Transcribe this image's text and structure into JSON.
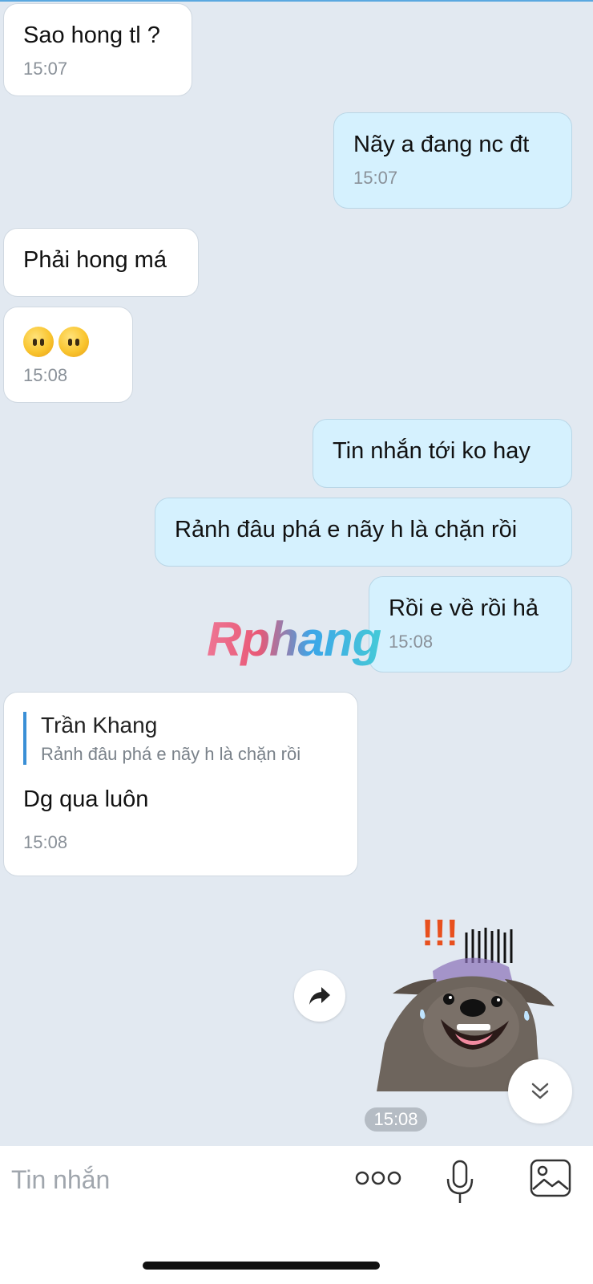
{
  "messages": [
    {
      "text": "Sao hong tl ?",
      "time": "15:07"
    },
    {
      "text": "Nãy a đang nc đt",
      "time": "15:07"
    },
    {
      "text": "Phải hong má"
    },
    {
      "emoji": [
        "neutral-face",
        "neutral-face"
      ],
      "time": "15:08"
    },
    {
      "text": "Tin nhắn tới ko hay"
    },
    {
      "text": "Rảnh đâu phá e nãy h là chặn rồi"
    },
    {
      "text": "Rồi e về rồi hả",
      "time": "15:08"
    },
    {
      "reply": {
        "author": "Trần Khang",
        "quoted": "Rảnh đâu phá e nãy h là chặn rồi"
      },
      "text": "Dg qua luôn",
      "time": "15:08"
    }
  ],
  "sticker": {
    "icon": "dog-sticker",
    "time": "15:08"
  },
  "watermark": "Rphang",
  "composer": {
    "placeholder": "Tin nhắn"
  },
  "colors": {
    "background": "#e2e9f1",
    "incoming": "#ffffff",
    "outgoing": "#d5f1fe",
    "accent": "#3a8fd6"
  }
}
